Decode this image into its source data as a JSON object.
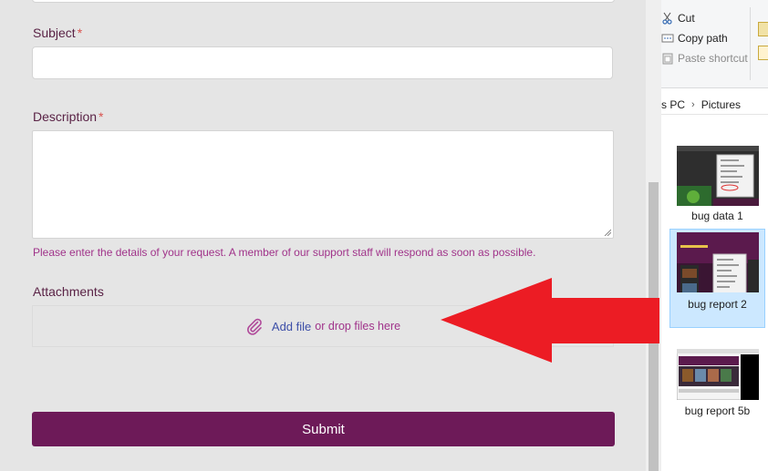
{
  "form": {
    "subject_label": "Subject",
    "required_mark": "*",
    "description_label": "Description",
    "description_hint": "Please enter the details of your request. A member of our support staff will respond as soon as possible.",
    "attachments_label": "Attachments",
    "add_file": "Add file",
    "drop_text": "or drop files here",
    "submit": "Submit"
  },
  "explorer": {
    "ribbon": {
      "cut": "Cut",
      "copy_path": "Copy path",
      "paste_shortcut": "Paste shortcut"
    },
    "address": {
      "pc": "s PC",
      "folder": "Pictures"
    },
    "files": [
      {
        "name": "bug data 1",
        "selected": false
      },
      {
        "name": "bug report 2",
        "selected": true
      },
      {
        "name": "bug report 5b",
        "selected": false
      }
    ]
  },
  "annotation": {
    "arrow_color": "#ec1c24"
  },
  "colors": {
    "brand": "#6d1a58",
    "hint": "#a0338a",
    "link": "#3d4fa8"
  }
}
